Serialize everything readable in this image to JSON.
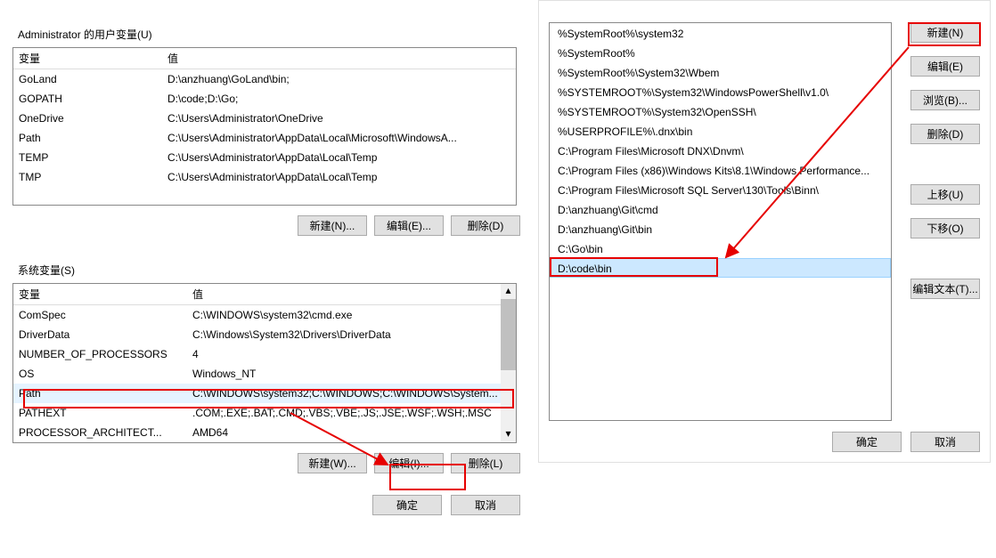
{
  "left": {
    "user_vars_label": "Administrator 的用户变量(U)",
    "sys_vars_label": "系统变量(S)",
    "col_name": "变量",
    "col_value": "值",
    "user_rows": [
      {
        "name": "GoLand",
        "value": "D:\\anzhuang\\GoLand\\bin;"
      },
      {
        "name": "GOPATH",
        "value": "D:\\code;D:\\Go;"
      },
      {
        "name": "OneDrive",
        "value": "C:\\Users\\Administrator\\OneDrive"
      },
      {
        "name": "Path",
        "value": "C:\\Users\\Administrator\\AppData\\Local\\Microsoft\\WindowsA..."
      },
      {
        "name": "TEMP",
        "value": "C:\\Users\\Administrator\\AppData\\Local\\Temp"
      },
      {
        "name": "TMP",
        "value": "C:\\Users\\Administrator\\AppData\\Local\\Temp"
      }
    ],
    "sys_rows": [
      {
        "name": "ComSpec",
        "value": "C:\\WINDOWS\\system32\\cmd.exe"
      },
      {
        "name": "DriverData",
        "value": "C:\\Windows\\System32\\Drivers\\DriverData"
      },
      {
        "name": "NUMBER_OF_PROCESSORS",
        "value": "4"
      },
      {
        "name": "OS",
        "value": "Windows_NT"
      },
      {
        "name": "Path",
        "value": "C:\\WINDOWS\\system32;C:\\WINDOWS;C:\\WINDOWS\\System...",
        "selected": true
      },
      {
        "name": "PATHEXT",
        "value": ".COM;.EXE;.BAT;.CMD;.VBS;.VBE;.JS;.JSE;.WSF;.WSH;.MSC"
      },
      {
        "name": "PROCESSOR_ARCHITECT...",
        "value": "AMD64"
      }
    ],
    "buttons": {
      "user_new": "新建(N)...",
      "user_edit": "编辑(E)...",
      "user_delete": "删除(D)",
      "sys_new": "新建(W)...",
      "sys_edit": "编辑(I)...",
      "sys_delete": "删除(L)",
      "ok": "确定",
      "cancel": "取消"
    }
  },
  "right": {
    "paths": [
      "%SystemRoot%\\system32",
      "%SystemRoot%",
      "%SystemRoot%\\System32\\Wbem",
      "%SYSTEMROOT%\\System32\\WindowsPowerShell\\v1.0\\",
      "%SYSTEMROOT%\\System32\\OpenSSH\\",
      "%USERPROFILE%\\.dnx\\bin",
      "C:\\Program Files\\Microsoft DNX\\Dnvm\\",
      "C:\\Program Files (x86)\\Windows Kits\\8.1\\Windows Performance...",
      "C:\\Program Files\\Microsoft SQL Server\\130\\Tools\\Binn\\",
      "D:\\anzhuang\\Git\\cmd",
      "D:\\anzhuang\\Git\\bin",
      "C:\\Go\\bin",
      "D:\\code\\bin"
    ],
    "selected_index": 12,
    "buttons": {
      "new": "新建(N)",
      "edit": "编辑(E)",
      "browse": "浏览(B)...",
      "delete": "删除(D)",
      "up": "上移(U)",
      "down": "下移(O)",
      "edit_text": "编辑文本(T)...",
      "ok": "确定",
      "cancel": "取消"
    }
  }
}
